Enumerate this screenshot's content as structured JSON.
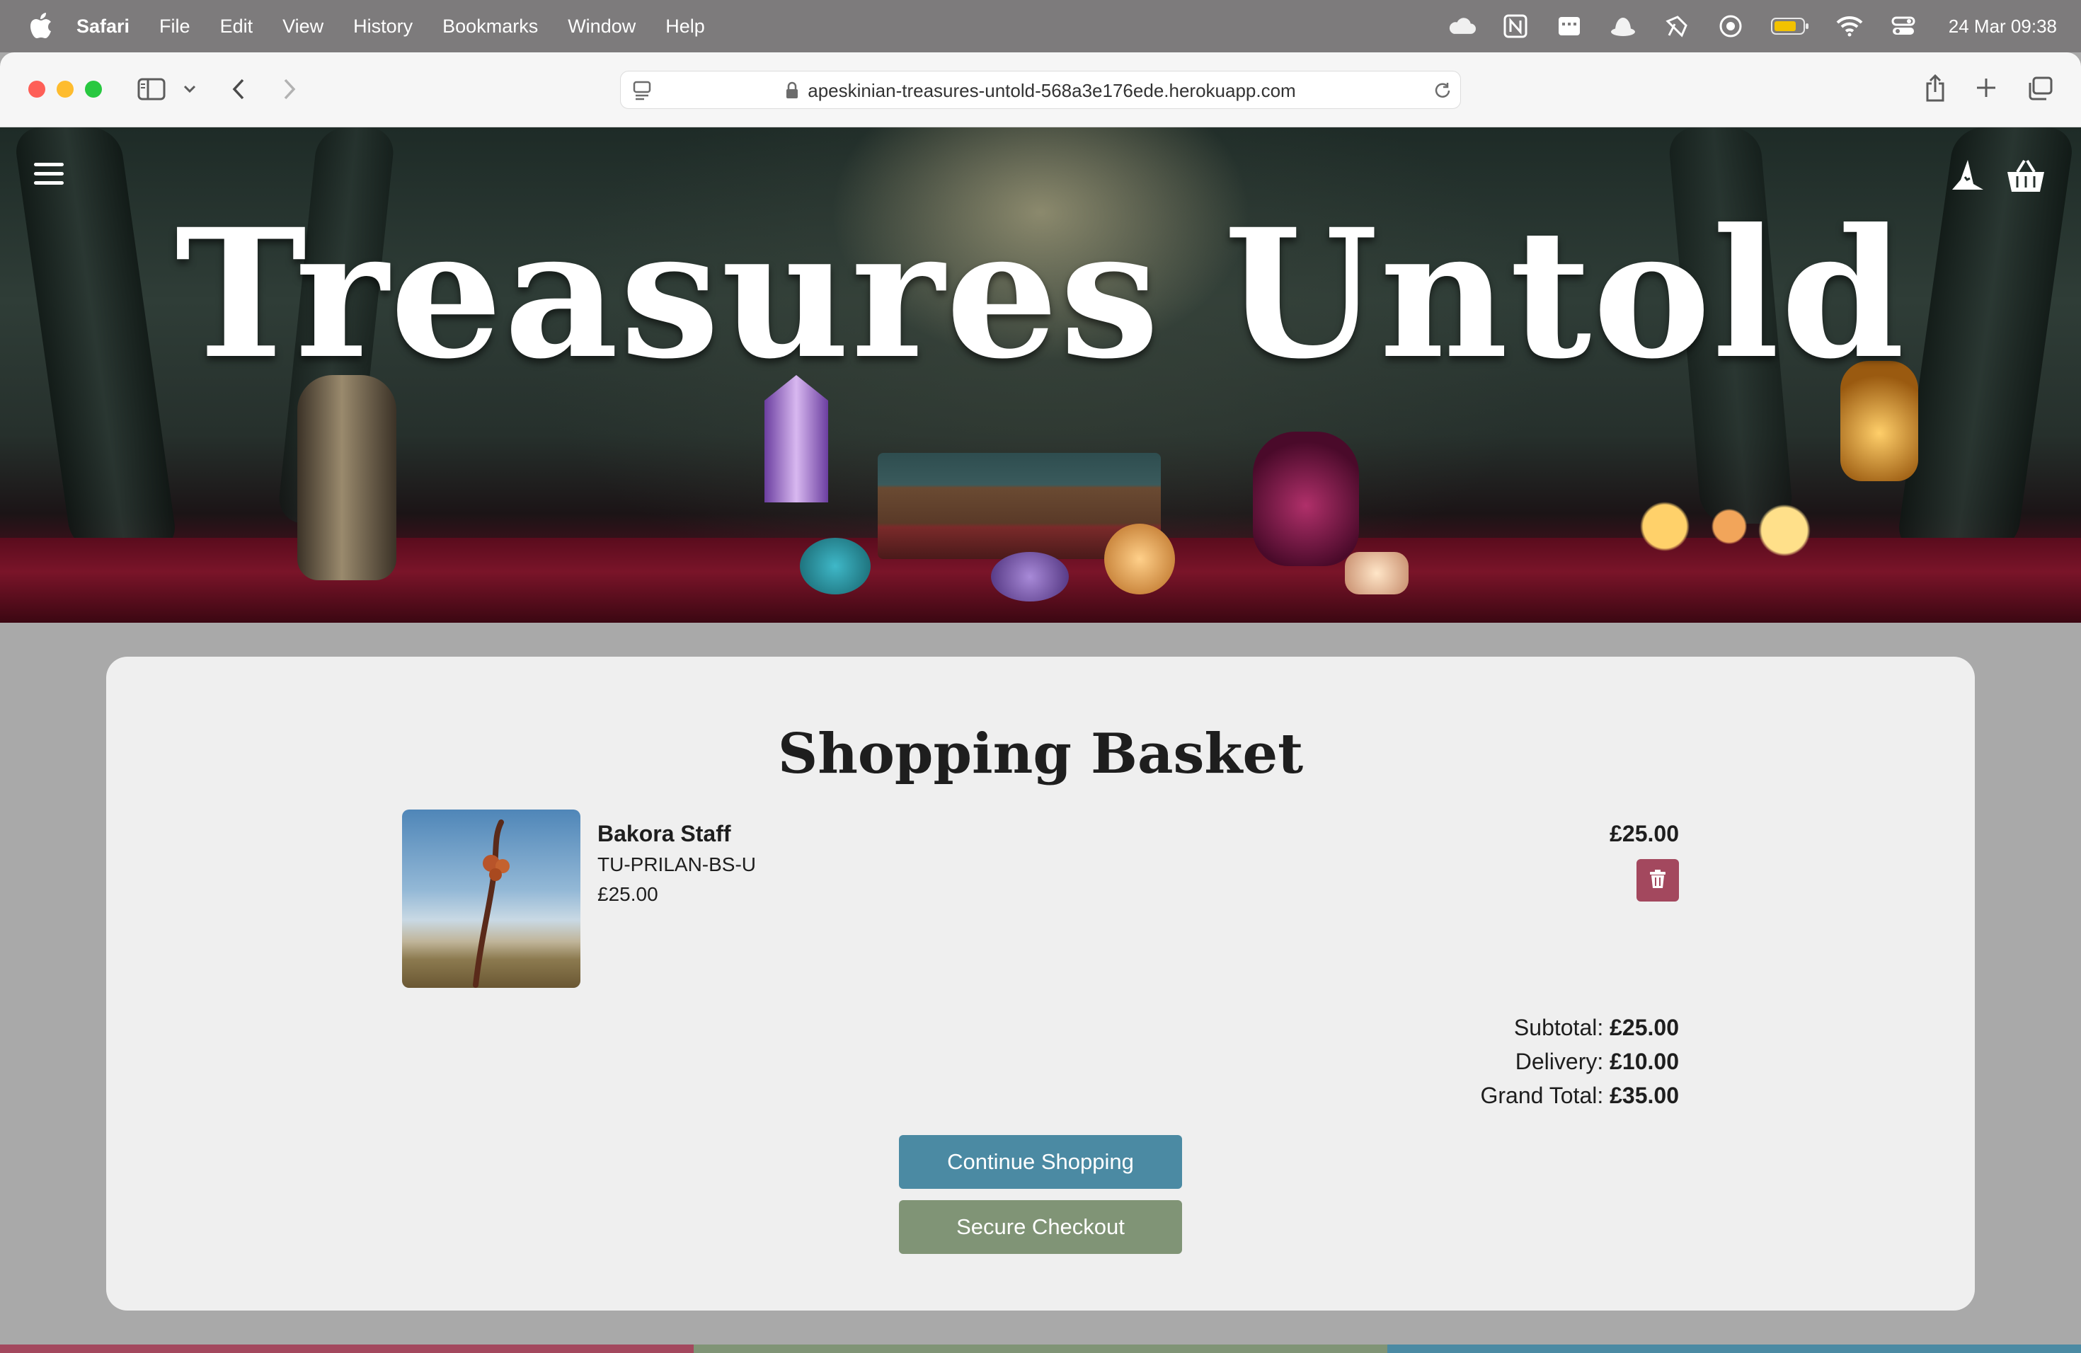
{
  "menubar": {
    "app": "Safari",
    "items": [
      "File",
      "Edit",
      "View",
      "History",
      "Bookmarks",
      "Window",
      "Help"
    ],
    "clock": "24 Mar  09:38",
    "status_icons": [
      "cloud-icon",
      "notion-icon",
      "calendar-icon",
      "hat-icon",
      "tool-icon",
      "record-icon",
      "battery-icon",
      "wifi-icon",
      "control-center-icon"
    ]
  },
  "browser": {
    "url": "apeskinian-treasures-untold-568a3e176ede.herokuapp.com"
  },
  "hero": {
    "title": "Treasures Untold"
  },
  "basket": {
    "heading": "Shopping Basket",
    "item": {
      "name": "Bakora Staff",
      "sku": "TU-PRILAN-BS-U",
      "price": "£25.00",
      "line_total": "£25.00"
    },
    "totals": {
      "subtotal_label": "Subtotal:",
      "subtotal": "£25.00",
      "delivery_label": "Delivery:",
      "delivery": "£10.00",
      "grand_label": "Grand Total:",
      "grand": "£35.00"
    },
    "continue_label": "Continue Shopping",
    "checkout_label": "Secure Checkout"
  },
  "colors": {
    "accent_blue": "#4b8aa3",
    "accent_green": "#809476",
    "delete_red": "#a3485e",
    "footer_stripe": [
      "#a3485e",
      "#809476",
      "#4b8aa3"
    ]
  }
}
